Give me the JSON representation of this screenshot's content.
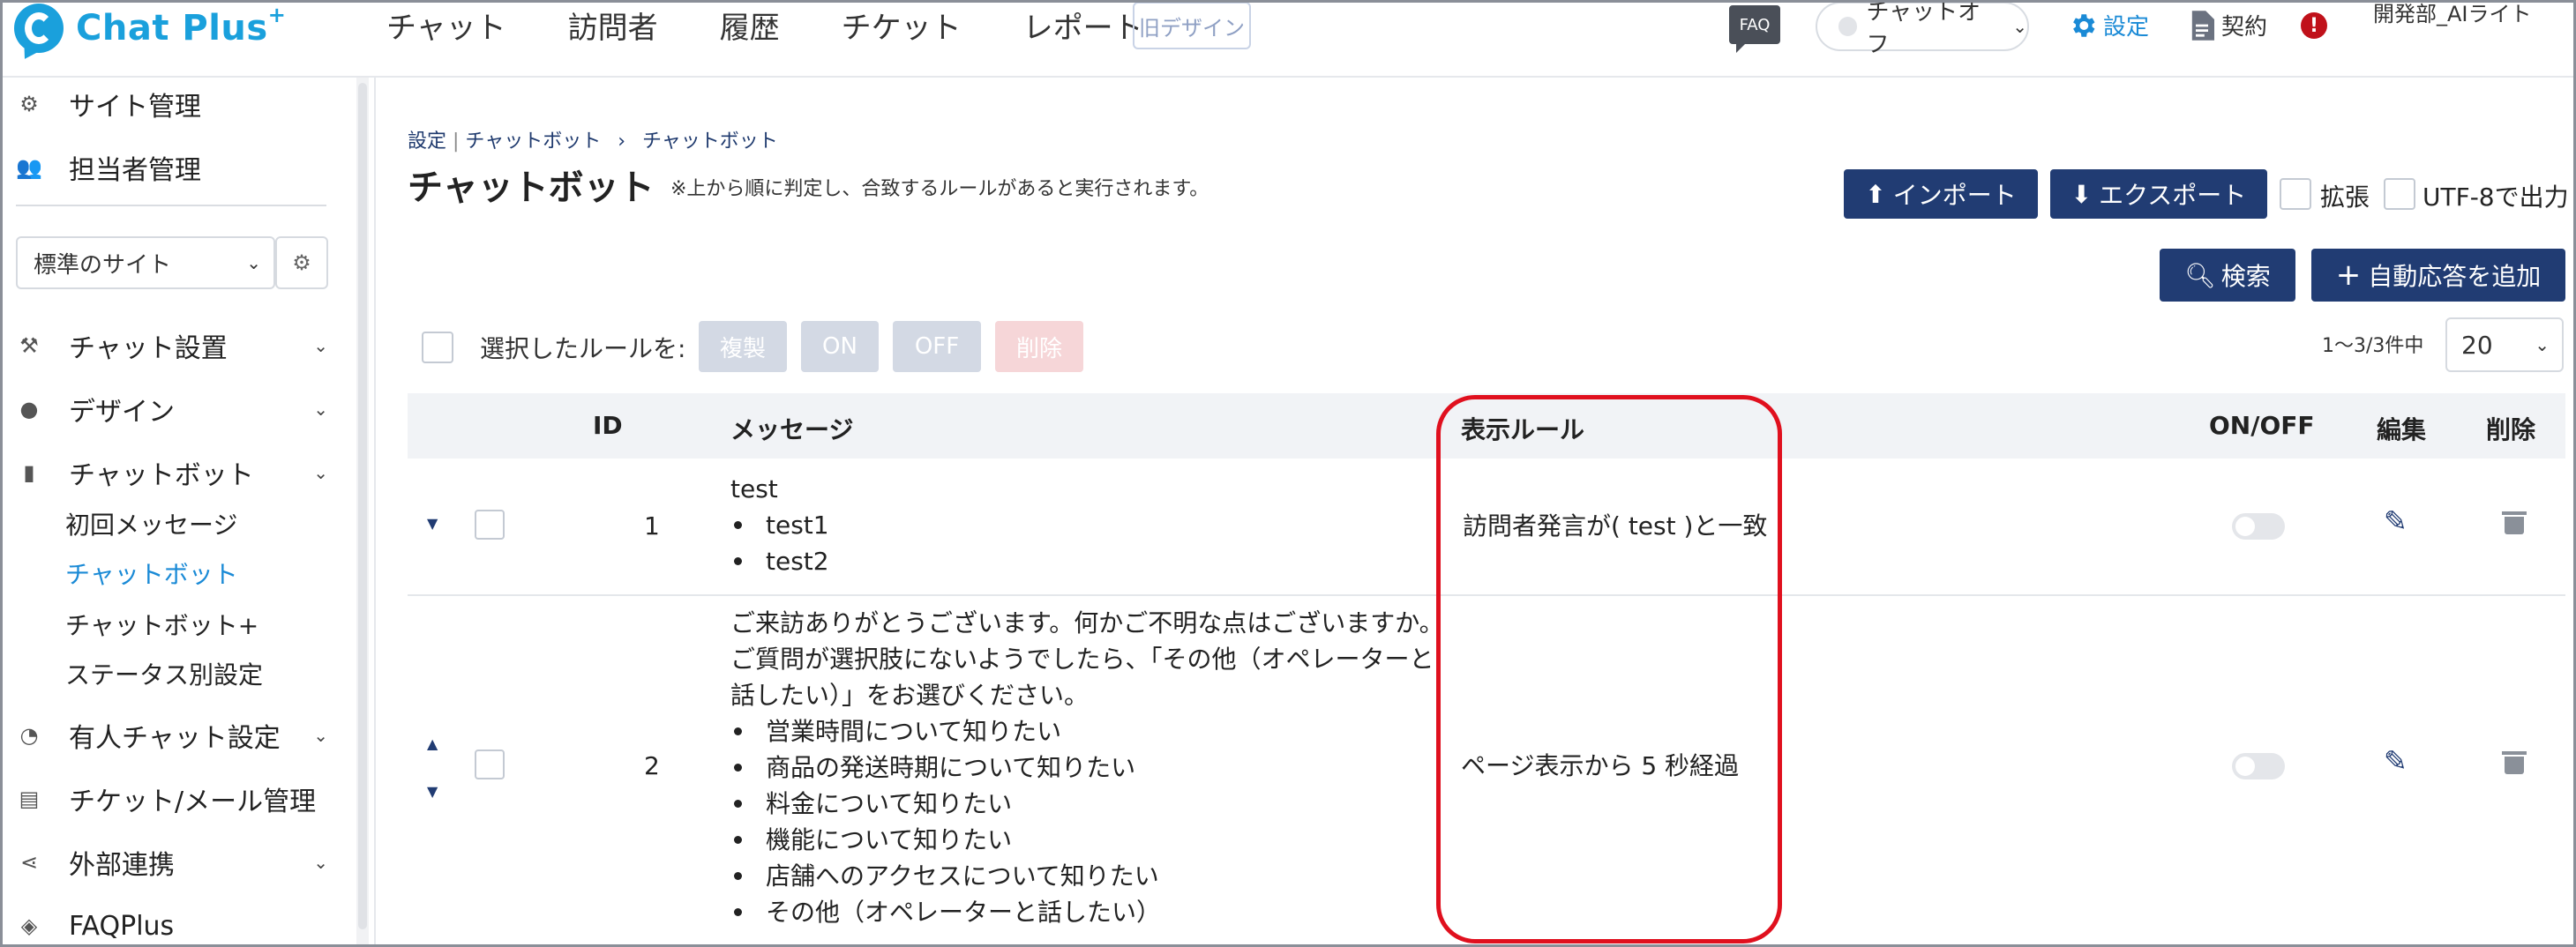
{
  "header": {
    "logo_text": "Chat Plus",
    "logo_sup": "+",
    "nav": [
      "チャット",
      "訪問者",
      "履歴",
      "チケット",
      "レポート"
    ],
    "old_design": "旧デザイン",
    "faq": "FAQ",
    "status": "チャットオフ",
    "settings": "設定",
    "contract": "契約",
    "alert": "!",
    "user": "開発部_AIライト"
  },
  "sidebar": {
    "site_manage": "サイト管理",
    "staff_manage": "担当者管理",
    "site_select": "標準のサイト",
    "chat_setup": "チャット設置",
    "design": "デザイン",
    "chatbot": "チャットボット",
    "chatbot_subs": [
      "初回メッセージ",
      "チャットボット",
      "チャットボット+",
      "ステータス別設定"
    ],
    "human_chat": "有人チャット設定",
    "ticket_mail": "チケット/メール管理",
    "external": "外部連携",
    "faqplus": "FAQPlus"
  },
  "breadcrumb": {
    "root": "設定",
    "mid": "チャットボット",
    "sep": "›",
    "current": "チャットボット"
  },
  "page": {
    "title": "チャットボット",
    "note": "※上から順に判定し、合致するルールがあると実行されます。",
    "import": "インポート",
    "export": "エクスポート",
    "extend": "拡張",
    "utf8": "UTF-8で出力",
    "search": "検索",
    "add": "自動応答を追加",
    "selected_rules": "選択したルールを:",
    "copy": "複製",
    "on": "ON",
    "off": "OFF",
    "delete": "削除",
    "count": "1〜3/3件中",
    "page_size": "20"
  },
  "table": {
    "headers": {
      "id": "ID",
      "message": "メッセージ",
      "rule": "表示ルール",
      "onoff": "ON/OFF",
      "edit": "編集",
      "delete": "削除"
    },
    "rows": [
      {
        "id": "1",
        "lines": [
          "test"
        ],
        "items": [
          "test1",
          "test2"
        ],
        "rule": "訪問者発言が( test )と一致",
        "enabled": false
      },
      {
        "id": "2",
        "lines": [
          "ご来訪ありがとうございます。何かご不明な点はございますか。",
          "ご質問が選択肢にないようでしたら、「その他（オペレーターと",
          "話したい）」をお選びください。"
        ],
        "items": [
          "営業時間について知りたい",
          "商品の発送時期について知りたい",
          "料金について知りたい",
          "機能について知りたい",
          "店舗へのアクセスについて知りたい",
          "その他（オペレーターと話したい）"
        ],
        "rule": "ページ表示から 5 秒経過",
        "enabled": false
      }
    ]
  },
  "colors": {
    "navy": "#213c73",
    "accent": "#1a8ad6",
    "highlight": "#e0101e"
  }
}
